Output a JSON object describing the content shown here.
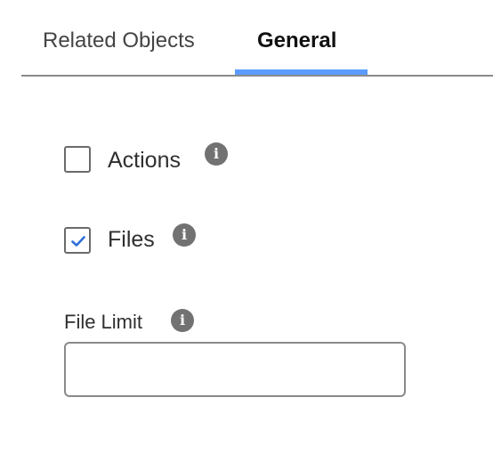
{
  "tabs": [
    {
      "label": "Related Objects",
      "active": false
    },
    {
      "label": "General",
      "active": true
    }
  ],
  "accent_color": "#5b9bff",
  "options": [
    {
      "label": "Actions",
      "checked": false,
      "icon": "info-icon"
    },
    {
      "label": "Files",
      "checked": true,
      "icon": "info-icon"
    }
  ],
  "file_limit": {
    "label": "File Limit",
    "value": "",
    "icon": "info-icon"
  }
}
